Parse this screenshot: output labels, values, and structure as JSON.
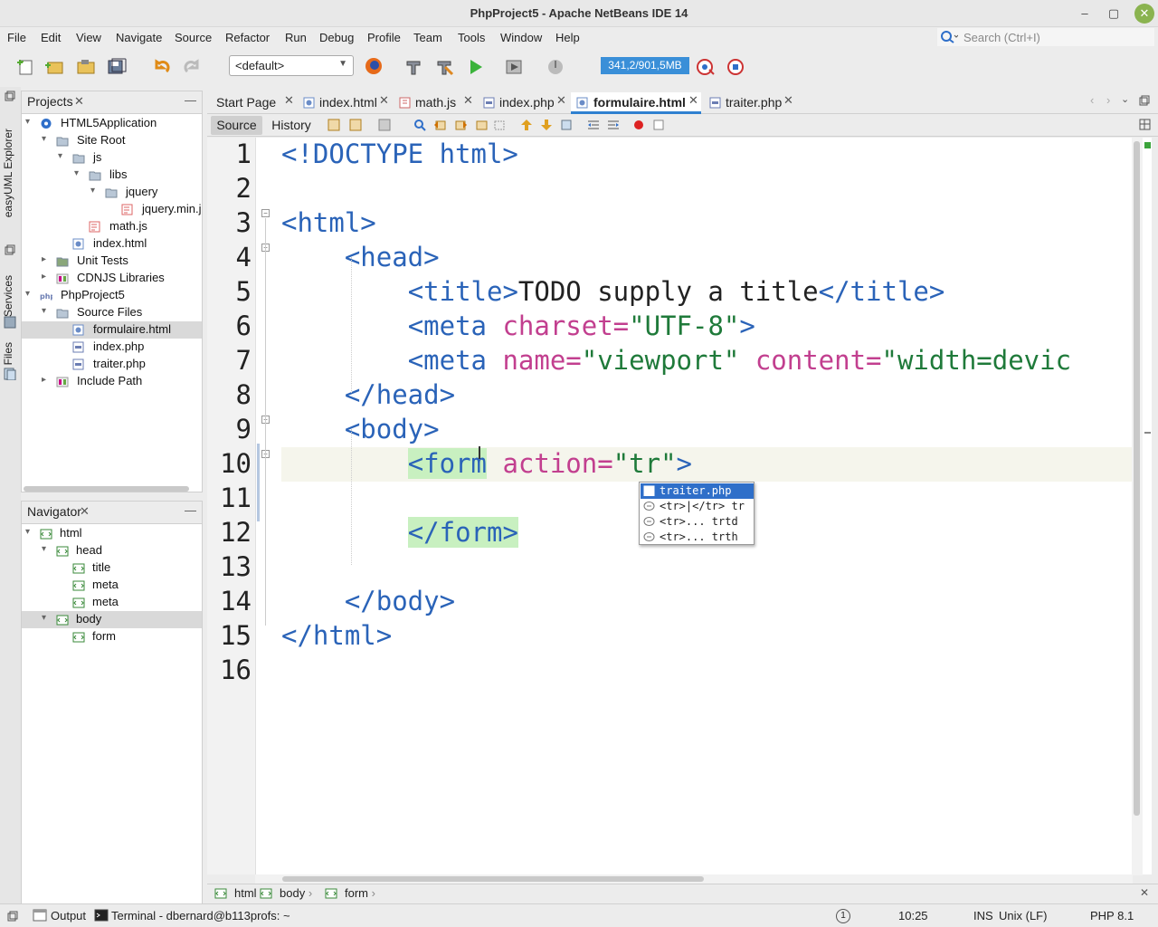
{
  "window": {
    "title": "PhpProject5 - Apache NetBeans IDE 14"
  },
  "menu": [
    "File",
    "Edit",
    "View",
    "Navigate",
    "Source",
    "Refactor",
    "Run",
    "Debug",
    "Profile",
    "Team",
    "Tools",
    "Window",
    "Help"
  ],
  "search": {
    "placeholder": "Search (Ctrl+I)"
  },
  "toolbar": {
    "config": "<default>",
    "memory": "341,2/901,5MB"
  },
  "projects": {
    "title": "Projects",
    "tree": [
      {
        "label": "HTML5Application",
        "indent": 0,
        "toggle": "▾",
        "icon": "project-icon",
        "color": "#2f6fc9"
      },
      {
        "label": "Site Root",
        "indent": 1,
        "toggle": "▾",
        "icon": "folder-icon",
        "color": "#b9c7d6"
      },
      {
        "label": "js",
        "indent": 2,
        "toggle": "▾",
        "icon": "folder-icon",
        "color": "#b9c7d6"
      },
      {
        "label": "libs",
        "indent": 3,
        "toggle": "▾",
        "icon": "folder-icon",
        "color": "#b9c7d6"
      },
      {
        "label": "jquery",
        "indent": 4,
        "toggle": "▾",
        "icon": "folder-icon",
        "color": "#b9c7d6"
      },
      {
        "label": "jquery.min.j",
        "indent": 5,
        "toggle": "",
        "icon": "js-file-icon",
        "color": "#d66"
      },
      {
        "label": "math.js",
        "indent": 3,
        "toggle": "",
        "icon": "js-file-icon",
        "color": "#d66"
      },
      {
        "label": "index.html",
        "indent": 2,
        "toggle": "",
        "icon": "html-file-icon",
        "color": "#6a8cc7"
      },
      {
        "label": "Unit Tests",
        "indent": 1,
        "toggle": "▸",
        "icon": "folder-icon",
        "color": "#8aa77a"
      },
      {
        "label": "CDNJS Libraries",
        "indent": 1,
        "toggle": "▸",
        "icon": "library-icon",
        "color": "#c08"
      },
      {
        "label": "PhpProject5",
        "indent": 0,
        "toggle": "▾",
        "icon": "php-project-icon",
        "color": "#6b7db3"
      },
      {
        "label": "Source Files",
        "indent": 1,
        "toggle": "▾",
        "icon": "folder-icon",
        "color": "#b9c7d6"
      },
      {
        "label": "formulaire.html",
        "indent": 2,
        "toggle": "",
        "icon": "html-file-icon",
        "color": "#6a8cc7",
        "selected": true
      },
      {
        "label": "index.php",
        "indent": 2,
        "toggle": "",
        "icon": "php-file-icon",
        "color": "#6b7db3"
      },
      {
        "label": "traiter.php",
        "indent": 2,
        "toggle": "",
        "icon": "php-file-icon",
        "color": "#6b7db3"
      },
      {
        "label": "Include Path",
        "indent": 1,
        "toggle": "▸",
        "icon": "library-icon",
        "color": "#c08"
      }
    ]
  },
  "navigator": {
    "title": "Navigator",
    "tree": [
      {
        "label": "html",
        "indent": 0,
        "toggle": "▾"
      },
      {
        "label": "head",
        "indent": 1,
        "toggle": "▾"
      },
      {
        "label": "title",
        "indent": 2,
        "toggle": ""
      },
      {
        "label": "meta",
        "indent": 2,
        "toggle": ""
      },
      {
        "label": "meta",
        "indent": 2,
        "toggle": ""
      },
      {
        "label": "body",
        "indent": 1,
        "toggle": "▾",
        "selected": true
      },
      {
        "label": "form",
        "indent": 2,
        "toggle": ""
      }
    ]
  },
  "side_tabs": [
    "easyUML Explorer",
    "Services",
    "Files"
  ],
  "editor_tabs": [
    {
      "label": "Start Page",
      "active": false
    },
    {
      "label": "index.html",
      "active": false
    },
    {
      "label": "math.js",
      "active": false
    },
    {
      "label": "index.php",
      "active": false
    },
    {
      "label": "formulaire.html",
      "active": true
    },
    {
      "label": "traiter.php",
      "active": false
    }
  ],
  "editor_modes": {
    "source": "Source",
    "history": "History"
  },
  "code_lines": [
    {
      "n": "1",
      "tokens": [
        [
          "tag",
          "<!DOCTYPE html>"
        ]
      ]
    },
    {
      "n": "2",
      "tokens": []
    },
    {
      "n": "3",
      "tokens": [
        [
          "tag",
          "<html>"
        ]
      ]
    },
    {
      "n": "4",
      "tokens": [
        [
          "plain",
          "    "
        ],
        [
          "tag",
          "<head>"
        ]
      ]
    },
    {
      "n": "5",
      "tokens": [
        [
          "plain",
          "        "
        ],
        [
          "tag",
          "<title>"
        ],
        [
          "plain",
          "TODO supply a title"
        ],
        [
          "tag",
          "</title>"
        ]
      ]
    },
    {
      "n": "6",
      "tokens": [
        [
          "plain",
          "        "
        ],
        [
          "tag",
          "<meta "
        ],
        [
          "attr",
          "charset="
        ],
        [
          "str",
          "\"UTF-8\""
        ],
        [
          "tag",
          ">"
        ]
      ]
    },
    {
      "n": "7",
      "tokens": [
        [
          "plain",
          "        "
        ],
        [
          "tag",
          "<meta "
        ],
        [
          "attr",
          "name="
        ],
        [
          "str",
          "\"viewport\" "
        ],
        [
          "attr",
          "content="
        ],
        [
          "str",
          "\"width=devic"
        ]
      ]
    },
    {
      "n": "8",
      "tokens": [
        [
          "plain",
          "    "
        ],
        [
          "tag",
          "</head>"
        ]
      ]
    },
    {
      "n": "9",
      "tokens": [
        [
          "plain",
          "    "
        ],
        [
          "tag",
          "<body>"
        ]
      ]
    },
    {
      "n": "10",
      "tokens": [
        [
          "plain",
          "        "
        ],
        [
          "hltag",
          "<form"
        ],
        [
          "plain",
          " "
        ],
        [
          "attr",
          "action="
        ],
        [
          "str",
          "\"tr\""
        ],
        [
          "tag",
          ">"
        ]
      ]
    },
    {
      "n": "11",
      "tokens": []
    },
    {
      "n": "12",
      "tokens": [
        [
          "plain",
          "        "
        ],
        [
          "hltag",
          "</form>"
        ]
      ]
    },
    {
      "n": "13",
      "tokens": []
    },
    {
      "n": "14",
      "tokens": [
        [
          "plain",
          "    "
        ],
        [
          "tag",
          "</body>"
        ]
      ]
    },
    {
      "n": "15",
      "tokens": [
        [
          "tag",
          "</html>"
        ]
      ]
    },
    {
      "n": "16",
      "tokens": []
    }
  ],
  "completion": [
    {
      "label": "traiter.php",
      "icon": "php-file-icon",
      "selected": true
    },
    {
      "label": "<tr>|</tr> tr",
      "icon": "snippet-icon",
      "selected": false
    },
    {
      "label": "<tr>...  trtd",
      "icon": "snippet-icon",
      "selected": false
    },
    {
      "label": "<tr>...  trth",
      "icon": "snippet-icon",
      "selected": false
    }
  ],
  "breadcrumbs": [
    "html",
    "body",
    "form"
  ],
  "status": {
    "output": "Output",
    "terminal": "Terminal - dbernard@b113profs: ~",
    "notifications": "1",
    "position": "10:25",
    "mode": "INS",
    "line_endings": "Unix (LF)",
    "php": "PHP 8.1"
  }
}
